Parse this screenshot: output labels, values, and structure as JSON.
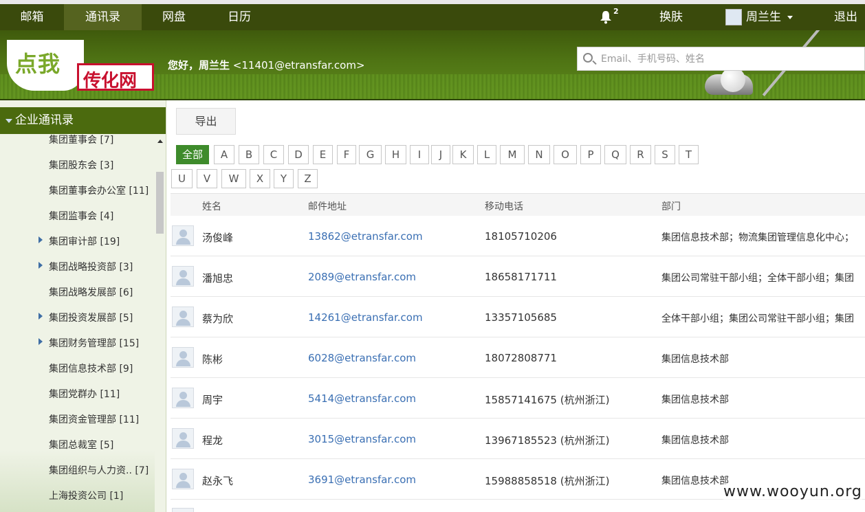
{
  "topnav": {
    "tabs": [
      {
        "label": "邮箱"
      },
      {
        "label": "通讯录"
      },
      {
        "label": "网盘"
      },
      {
        "label": "日历"
      }
    ],
    "bell_count": "2",
    "skin_label": "换肤",
    "user_label": "周兰生",
    "logout_label": "退出"
  },
  "banner": {
    "logo_left": "点我",
    "logo_right": "传化网",
    "greeting_name": "您好，周兰生",
    "greeting_email": "<11401@etransfar.com>",
    "search_placeholder": "Email、手机号码、姓名"
  },
  "sidebar": {
    "title": "企业通讯录",
    "items": [
      {
        "label": "集团董事会 [7]"
      },
      {
        "label": "集团股东会 [3]"
      },
      {
        "label": "集团董事会办公室 [11]"
      },
      {
        "label": "集团监事会 [4]"
      },
      {
        "label": "集团审计部 [19]"
      },
      {
        "label": "集团战略投资部 [3]"
      },
      {
        "label": "集团战略发展部 [6]"
      },
      {
        "label": "集团投资发展部 [5]"
      },
      {
        "label": "集团财务管理部 [15]"
      },
      {
        "label": "集团信息技术部 [9]"
      },
      {
        "label": "集团党群办 [11]"
      },
      {
        "label": "集团资金管理部 [11]"
      },
      {
        "label": "集团总裁室 [5]"
      },
      {
        "label": "集团组织与人力资.. [7]"
      },
      {
        "label": "上海投资公司 [1]"
      }
    ]
  },
  "toolbar": {
    "export_label": "导出"
  },
  "letters": [
    "全部",
    "A",
    "B",
    "C",
    "D",
    "E",
    "F",
    "G",
    "H",
    "I",
    "J",
    "K",
    "L",
    "M",
    "N",
    "O",
    "P",
    "Q",
    "R",
    "S",
    "T",
    "U",
    "V",
    "W",
    "X",
    "Y",
    "Z"
  ],
  "table": {
    "headers": {
      "name": "姓名",
      "email": "邮件地址",
      "mobile": "移动电话",
      "dept": "部门"
    },
    "rows": [
      {
        "name": "汤俊峰",
        "email": "13862@etransfar.com",
        "mobile": "18105710206",
        "dept": "集团信息技术部；物流集团管理信息化中心；"
      },
      {
        "name": "潘旭忠",
        "email": "2089@etransfar.com",
        "mobile": "18658171711",
        "dept": "集团公司常驻干部小组；全体干部小组；集团"
      },
      {
        "name": "蔡为欣",
        "email": "14261@etransfar.com",
        "mobile": "13357105685",
        "dept": "全体干部小组；集团公司常驻干部小组；集团"
      },
      {
        "name": "陈彬",
        "email": "6028@etransfar.com",
        "mobile": "18072808771",
        "dept": "集团信息技术部"
      },
      {
        "name": "周宇",
        "email": "5414@etransfar.com",
        "mobile": "15857141675 (杭州浙江)",
        "dept": "集团信息技术部"
      },
      {
        "name": "程龙",
        "email": "3015@etransfar.com",
        "mobile": "13967185523 (杭州浙江)",
        "dept": "集团信息技术部"
      },
      {
        "name": "赵永飞",
        "email": "3691@etransfar.com",
        "mobile": "15988858518 (杭州浙江)",
        "dept": "集团信息技术部"
      }
    ]
  },
  "watermark": "www.wooyun.org"
}
